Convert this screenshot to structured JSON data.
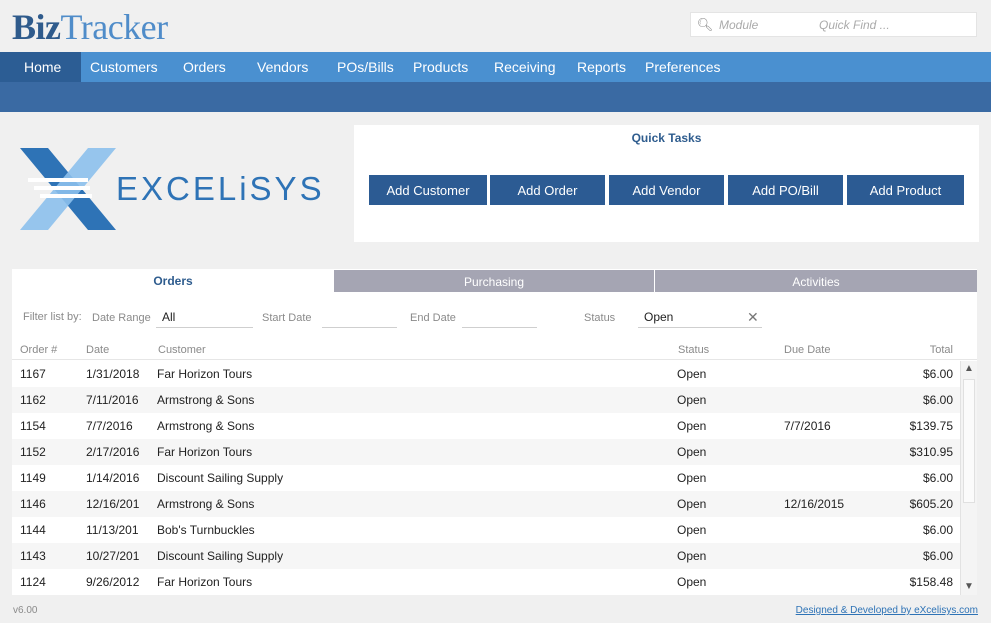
{
  "app": {
    "logo_part1": "Biz",
    "logo_part2": "Tracker",
    "version": "v6.00",
    "credit": "Designed & Developed by eXcelisys.com"
  },
  "search": {
    "module_placeholder": "Module",
    "quickfind_placeholder": "Quick Find ...",
    "icon": "search-icon"
  },
  "nav": {
    "items": [
      "Home",
      "Customers",
      "Orders",
      "Vendors",
      "POs/Bills",
      "Products",
      "Receiving",
      "Reports",
      "Preferences"
    ],
    "active": "Home"
  },
  "brand": {
    "name": "EXCELiSYS",
    "colors": {
      "dark": "#2e73b6",
      "light": "#8cc0ec"
    }
  },
  "quick_tasks": {
    "title": "Quick Tasks",
    "buttons": [
      "Add Customer",
      "Add Order",
      "Add Vendor",
      "Add PO/Bill",
      "Add Product"
    ]
  },
  "tabs": {
    "items": [
      "Orders",
      "Purchasing",
      "Activities"
    ],
    "active": "Orders"
  },
  "filters": {
    "label": "Filter list by:",
    "date_range_label": "Date Range",
    "date_range_value": "All",
    "start_date_label": "Start Date",
    "start_date_value": "",
    "end_date_label": "End Date",
    "end_date_value": "",
    "status_label": "Status",
    "status_value": "Open"
  },
  "table": {
    "columns": [
      "Order #",
      "Date",
      "Customer",
      "Status",
      "Due Date",
      "Total"
    ],
    "rows": [
      [
        "1167",
        "1/31/2018",
        "Far Horizon Tours",
        "Open",
        "",
        "$6.00"
      ],
      [
        "1162",
        "7/11/2016",
        "Armstrong & Sons",
        "Open",
        "",
        "$6.00"
      ],
      [
        "1154",
        "7/7/2016",
        "Armstrong & Sons",
        "Open",
        "7/7/2016",
        "$139.75"
      ],
      [
        "1152",
        "2/17/2016",
        "Far Horizon Tours",
        "Open",
        "",
        "$310.95"
      ],
      [
        "1149",
        "1/14/2016",
        "Discount Sailing Supply",
        "Open",
        "",
        "$6.00"
      ],
      [
        "1146",
        "12/16/201",
        "Armstrong & Sons",
        "Open",
        "12/16/2015",
        "$605.20"
      ],
      [
        "1144",
        "11/13/201",
        "Bob's Turnbuckles",
        "Open",
        "",
        "$6.00"
      ],
      [
        "1143",
        "10/27/201",
        "Discount Sailing Supply",
        "Open",
        "",
        "$6.00"
      ],
      [
        "1124",
        "9/26/2012",
        "Far Horizon Tours",
        "Open",
        "",
        "$158.48"
      ]
    ]
  },
  "colors": {
    "nav_bar": "#4a90d0",
    "nav_active": "#2c5d94",
    "band": "#3a6aa3",
    "button": "#2c5b93",
    "tab_inactive": "#a5a5b3"
  }
}
